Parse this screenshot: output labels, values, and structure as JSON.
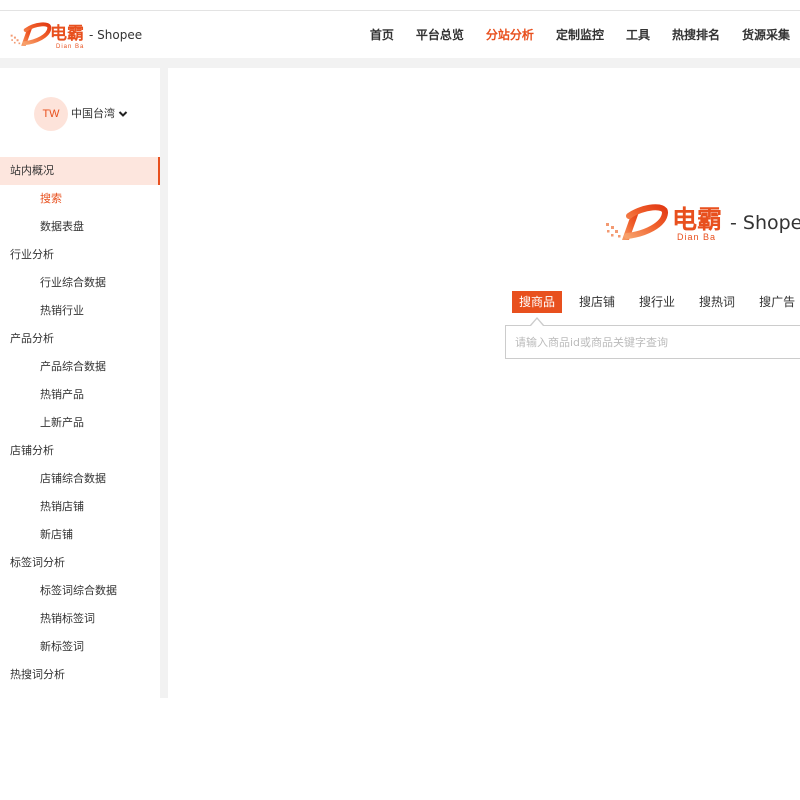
{
  "brand": {
    "name_cn": "电霸",
    "name_en": "Dian Ba",
    "suffix": "- Shopee",
    "icon": "brand-logo-icon"
  },
  "header": {
    "nav": [
      {
        "label": "首页",
        "active": false
      },
      {
        "label": "平台总览",
        "active": false
      },
      {
        "label": "分站分析",
        "active": true
      },
      {
        "label": "定制监控",
        "active": false
      },
      {
        "label": "工具",
        "active": false
      },
      {
        "label": "热搜排名",
        "active": false
      },
      {
        "label": "货源采集",
        "active": false
      }
    ]
  },
  "sidebar": {
    "region": {
      "code": "TW",
      "name": "中国台湾",
      "dropdown_icon": "chevron-down-icon"
    },
    "menu": [
      {
        "label": "站内概况",
        "active": true,
        "items": [
          {
            "label": "搜索",
            "active": true
          },
          {
            "label": "数据表盘",
            "active": false
          }
        ]
      },
      {
        "label": "行业分析",
        "active": false,
        "items": [
          {
            "label": "行业综合数据",
            "active": false
          },
          {
            "label": "热销行业",
            "active": false
          }
        ]
      },
      {
        "label": "产品分析",
        "active": false,
        "items": [
          {
            "label": "产品综合数据",
            "active": false
          },
          {
            "label": "热销产品",
            "active": false
          },
          {
            "label": "上新产品",
            "active": false
          }
        ]
      },
      {
        "label": "店铺分析",
        "active": false,
        "items": [
          {
            "label": "店铺综合数据",
            "active": false
          },
          {
            "label": "热销店铺",
            "active": false
          },
          {
            "label": "新店铺",
            "active": false
          }
        ]
      },
      {
        "label": "标签词分析",
        "active": false,
        "items": [
          {
            "label": "标签词综合数据",
            "active": false
          },
          {
            "label": "热销标签词",
            "active": false
          },
          {
            "label": "新标签词",
            "active": false
          }
        ]
      },
      {
        "label": "热搜词分析",
        "active": false,
        "items": []
      }
    ]
  },
  "main": {
    "search_tabs": [
      {
        "label": "搜商品",
        "active": true
      },
      {
        "label": "搜店铺",
        "active": false
      },
      {
        "label": "搜行业",
        "active": false
      },
      {
        "label": "搜热词",
        "active": false
      },
      {
        "label": "搜广告",
        "active": false
      }
    ],
    "search": {
      "value": "",
      "placeholder": "请输入商品id或商品关键字查询"
    }
  },
  "colors": {
    "brand": "#e8501e",
    "active_row_bg": "#fde6de",
    "avatar_bg": "#fde3da",
    "page_bg": "#f2f2f2",
    "text": "#333333",
    "placeholder": "#bbbbbb",
    "input_border": "#cccccc"
  }
}
